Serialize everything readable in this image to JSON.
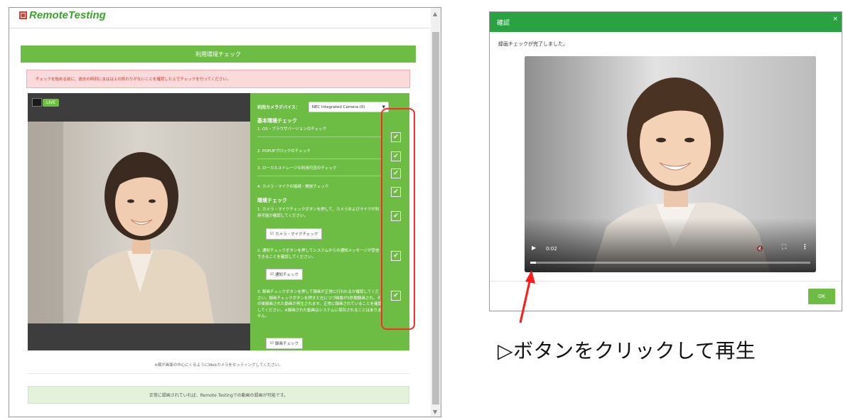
{
  "left_window": {
    "logo_text": "RemoteTesting",
    "title": "利用環境チェック",
    "alert": "チェックを始める前に、過去の時刻にまはは上の終わりがないことを確認した上でチェックを行ってください。",
    "camera": {
      "live_label": "LIVE"
    },
    "device": {
      "label": "利用カメラデバイス：",
      "selected": "NEC Integrated Camera (0("
    },
    "basic_section_title": "基本環境チェック",
    "basic_items": [
      "1. OS・ブラウザバージョンのチェック",
      "2. POPUPブロックのチェック",
      "3. ローカルストレージの利用可否のチェック",
      "4. カメラ・マイクの接続・開放チェック"
    ],
    "receive_section_title": "環境チェック",
    "receive_items": [
      "1. カメラ・マイクチェックボタンを押して、カメラおよびマイクが利用可能か確認してください。",
      "2. 通知チェックボタンを押してシステムからの通知メッセージが受信できることを確認してください。",
      "3. 録画チェックボタンを押して録画が正常に行われるか確認してください。録画チェックボタンを押すと左につづ映像が5秒間録画され、その後録画された動画が再生されます。正常に録画されていることを確認してください。※録画された動画はシステムに保存されることはありません。"
    ],
    "buttons": {
      "camera_mic": "カメラ・マイクチェック",
      "notify": "通知チェック",
      "record": "録画チェック"
    },
    "checks": [
      "✔",
      "✔",
      "✔",
      "✔",
      "✔",
      "✔",
      "✔"
    ],
    "note": "※顔が画面の中心にくるようにWebカメラをセッティングしてください。",
    "success_banner": "正常に録画されていれば、Remote Testingでの動画の録画が可能です。"
  },
  "dialog": {
    "title": "確認",
    "close": "×",
    "message": "録画チェックが完了しました。",
    "video": {
      "time": "0:02",
      "progress": 0.02
    },
    "ok_label": "OK"
  },
  "caption": "▷ボタンをクリックして再生",
  "colors": {
    "brand_green": "#6dbd45",
    "dialog_header": "#29a341",
    "highlight_red": "#ff2a2a"
  }
}
